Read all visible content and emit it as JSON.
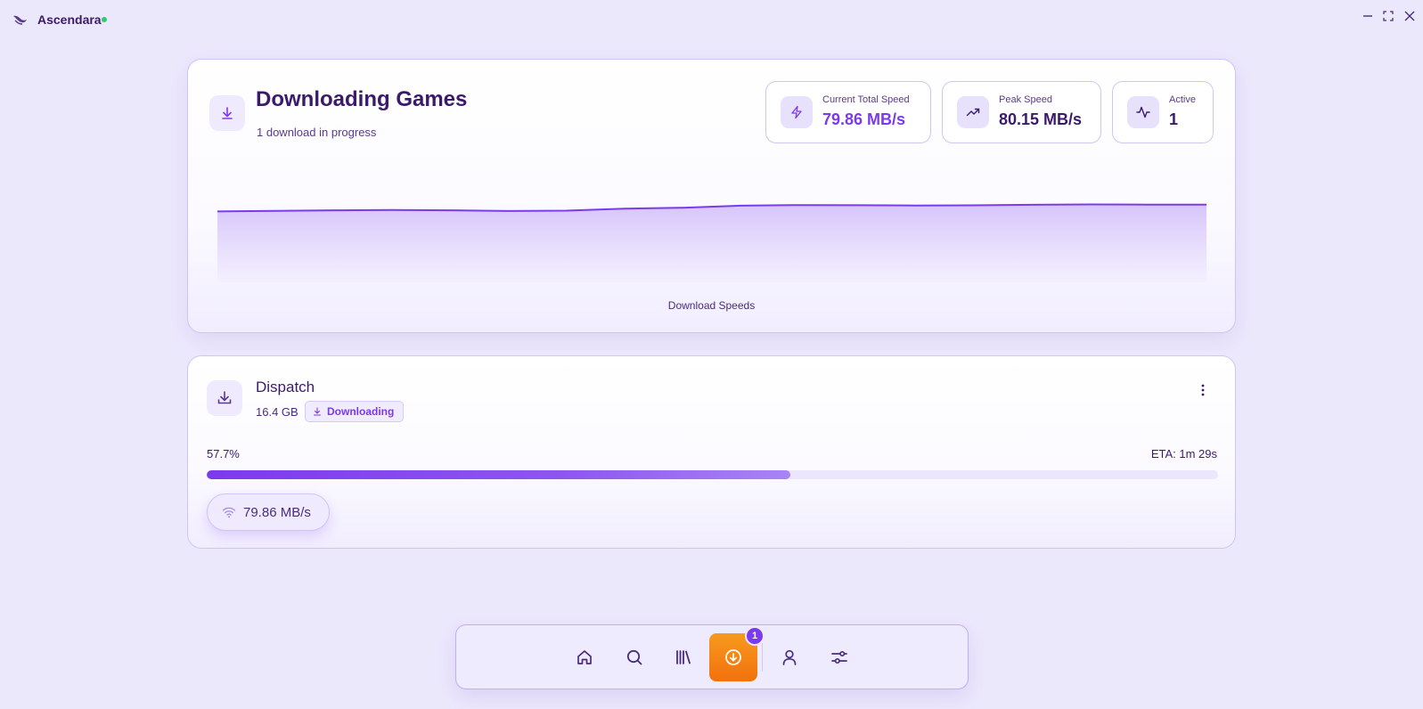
{
  "app": {
    "name": "Ascendara",
    "status_color": "#2ecc71"
  },
  "header": {
    "title": "Downloading Games",
    "subtitle": "1 download in progress"
  },
  "stats": [
    {
      "label": "Current Total Speed",
      "value": "79.86 MB/s",
      "icon": "zap-icon"
    },
    {
      "label": "Peak Speed",
      "value": "80.15 MB/s",
      "icon": "trending-up-icon"
    },
    {
      "label": "Active",
      "value": "1",
      "icon": "activity-icon"
    }
  ],
  "chart_data": {
    "type": "area",
    "title": "",
    "xlabel": "Download Speeds",
    "ylabel": "",
    "series": [
      {
        "values": [
          75.5,
          75.9,
          76.2,
          76.4,
          76.2,
          75.8,
          76.0,
          77.3,
          77.9,
          79.2,
          79.6,
          79.5,
          79.3,
          79.4,
          79.8,
          80.0,
          79.9,
          79.9
        ]
      }
    ],
    "grid": false,
    "legend": "none",
    "color": "#7c3aed"
  },
  "download": {
    "name": "Dispatch",
    "size": "16.4 GB",
    "status": "Downloading",
    "progress_label": "57.7%",
    "progress": 0.577,
    "eta": "ETA: 1m 29s",
    "speed": "79.86 MB/s"
  },
  "nav": {
    "items": [
      "home-icon",
      "search-icon",
      "library-icon",
      "downloads-icon",
      "profile-icon",
      "settings-sliders-icon"
    ],
    "active": "downloads-icon",
    "badge": "1"
  },
  "colors": {
    "accent": "#7c3aed",
    "active_nav": "#f2710c",
    "background": "#ece8fc"
  }
}
